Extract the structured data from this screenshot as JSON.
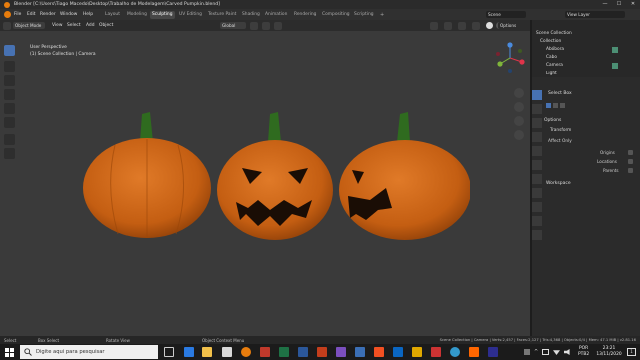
{
  "window": {
    "title": "Blender [C:\\Users\\Tiago Macedo\\Desktop\\Trabalho de Modelagem\\Carved Pumpkin.blend]",
    "buttons": [
      "—",
      "☐",
      "✕"
    ]
  },
  "menubar": {
    "menus": [
      "File",
      "Edit",
      "Render",
      "Window",
      "Help"
    ],
    "workspaces": [
      "Layout",
      "Modeling",
      "Sculpting",
      "UV Editing",
      "Texture Paint",
      "Shading",
      "Animation",
      "Rendering",
      "Compositing",
      "Scripting"
    ],
    "active_workspace": "Sculpting",
    "scene_label": "Scene",
    "view_layer_label": "View Layer"
  },
  "header": {
    "mode": "Object Mode",
    "menus": [
      "View",
      "Select",
      "Add",
      "Object"
    ],
    "transform_orientation": "Global",
    "options_label": "Options"
  },
  "viewport": {
    "perspective_label": "User Perspective",
    "collection_label": "(1) Scene Collection | Camera"
  },
  "outliner": {
    "rows": [
      {
        "label": "Scene Collection",
        "indent": 0
      },
      {
        "label": "Collection",
        "indent": 1
      },
      {
        "label": "Abóbora",
        "indent": 2
      },
      {
        "label": "Cabo",
        "indent": 2
      },
      {
        "label": "Camera",
        "indent": 2
      },
      {
        "label": "Light",
        "indent": 2
      }
    ]
  },
  "properties": {
    "tool_name": "Select Box",
    "options_header": "Options",
    "transform_header": "Transform",
    "affect_only": "Affect Only",
    "checkboxes": [
      "Origins",
      "Locations",
      "Parents"
    ],
    "workspace_header": "Workspace"
  },
  "statusbar": {
    "left": [
      {
        "icon": "mouse-left-icon",
        "label": "Select"
      },
      {
        "icon": "mouse-left-icon",
        "label": "Box Select"
      },
      {
        "icon": "mouse-middle-icon",
        "label": "Rotate View"
      },
      {
        "icon": "mouse-right-icon",
        "label": "Object Context Menu"
      }
    ],
    "right": "Scene Collection | Camera | Verts:2,457 | Faces:2,127 | Tris:4,368 | Objects:0/4 | Mem: 47.1 MiB | v2.81.16"
  },
  "taskbar": {
    "search_placeholder": "Digite aqui para pesquisar",
    "lang": "POR",
    "layout": "PTB2",
    "time": "23:21",
    "date": "13/11/2020",
    "notification_count": "1"
  },
  "colors": {
    "pumpkin": "#d2691e",
    "stem": "#2f6b1f",
    "accent": "#4772b3",
    "blender_orange": "#e87d0d"
  }
}
